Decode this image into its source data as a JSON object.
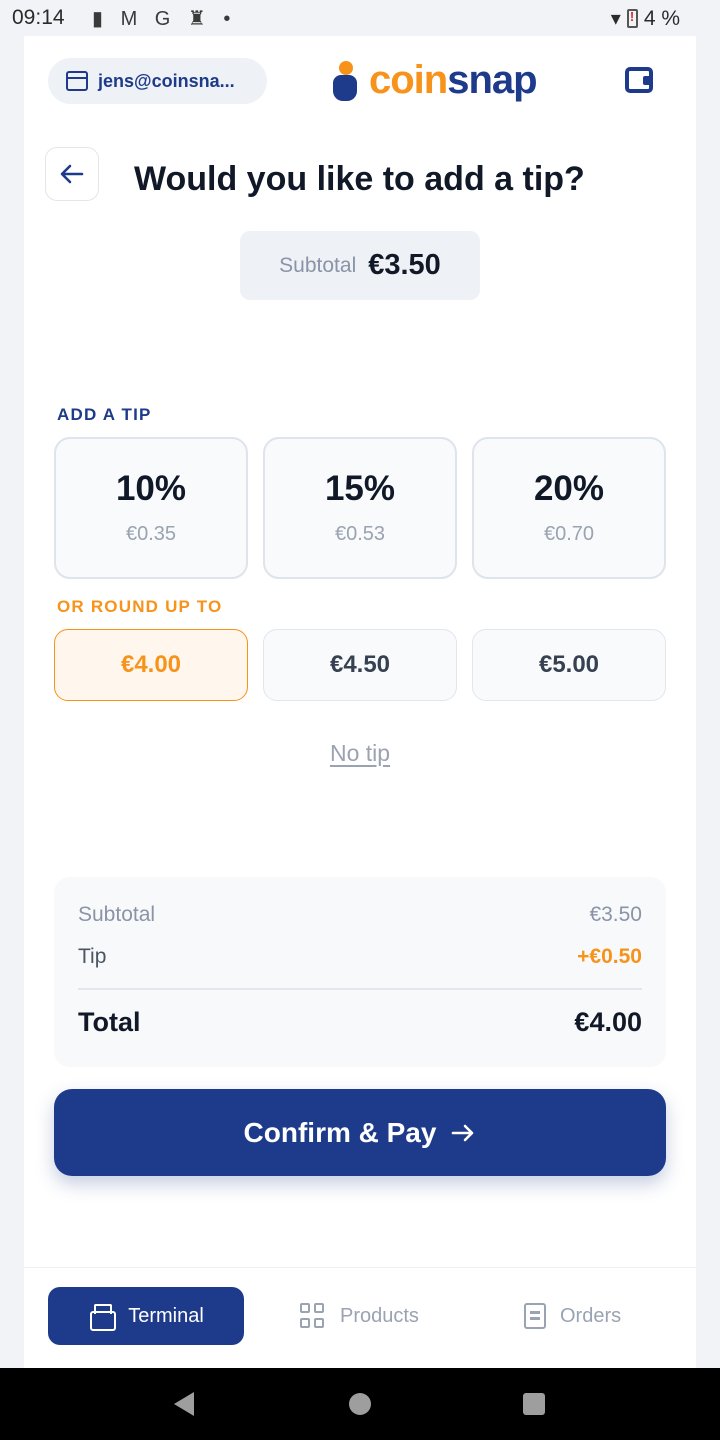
{
  "status_bar": {
    "time": "09:14",
    "notification_icons": [
      "alert-icon",
      "gmail-icon",
      "google-icon",
      "keyhole-icon",
      "dot-icon"
    ],
    "battery_percent": "4 %"
  },
  "header": {
    "account_email": "jens@coinsna...",
    "logo_coin": "coin",
    "logo_snap": "snap"
  },
  "page": {
    "title": "Would you like to add a tip?",
    "subtotal_label": "Subtotal",
    "subtotal_value": "€3.50"
  },
  "tip_section": {
    "label": "ADD A TIP",
    "options": [
      {
        "percent": "10%",
        "amount": "€0.35"
      },
      {
        "percent": "15%",
        "amount": "€0.53"
      },
      {
        "percent": "20%",
        "amount": "€0.70"
      }
    ]
  },
  "round_section": {
    "label": "OR ROUND UP TO",
    "options": [
      "€4.00",
      "€4.50",
      "€5.00"
    ],
    "selected": "€4.00"
  },
  "no_tip_label": "No tip",
  "summary": {
    "subtotal_label": "Subtotal",
    "subtotal_value": "€3.50",
    "tip_label": "Tip",
    "tip_value": "+€0.50",
    "total_label": "Total",
    "total_value": "€4.00"
  },
  "confirm_label": "Confirm & Pay",
  "bottom_nav": {
    "items": [
      {
        "label": "Terminal",
        "icon": "cash-register-icon",
        "active": true
      },
      {
        "label": "Products",
        "icon": "grid-icon",
        "active": false
      },
      {
        "label": "Orders",
        "icon": "receipt-icon",
        "active": false
      }
    ]
  },
  "colors": {
    "brand_blue": "#1e3a8a",
    "accent_orange": "#f7931a"
  }
}
